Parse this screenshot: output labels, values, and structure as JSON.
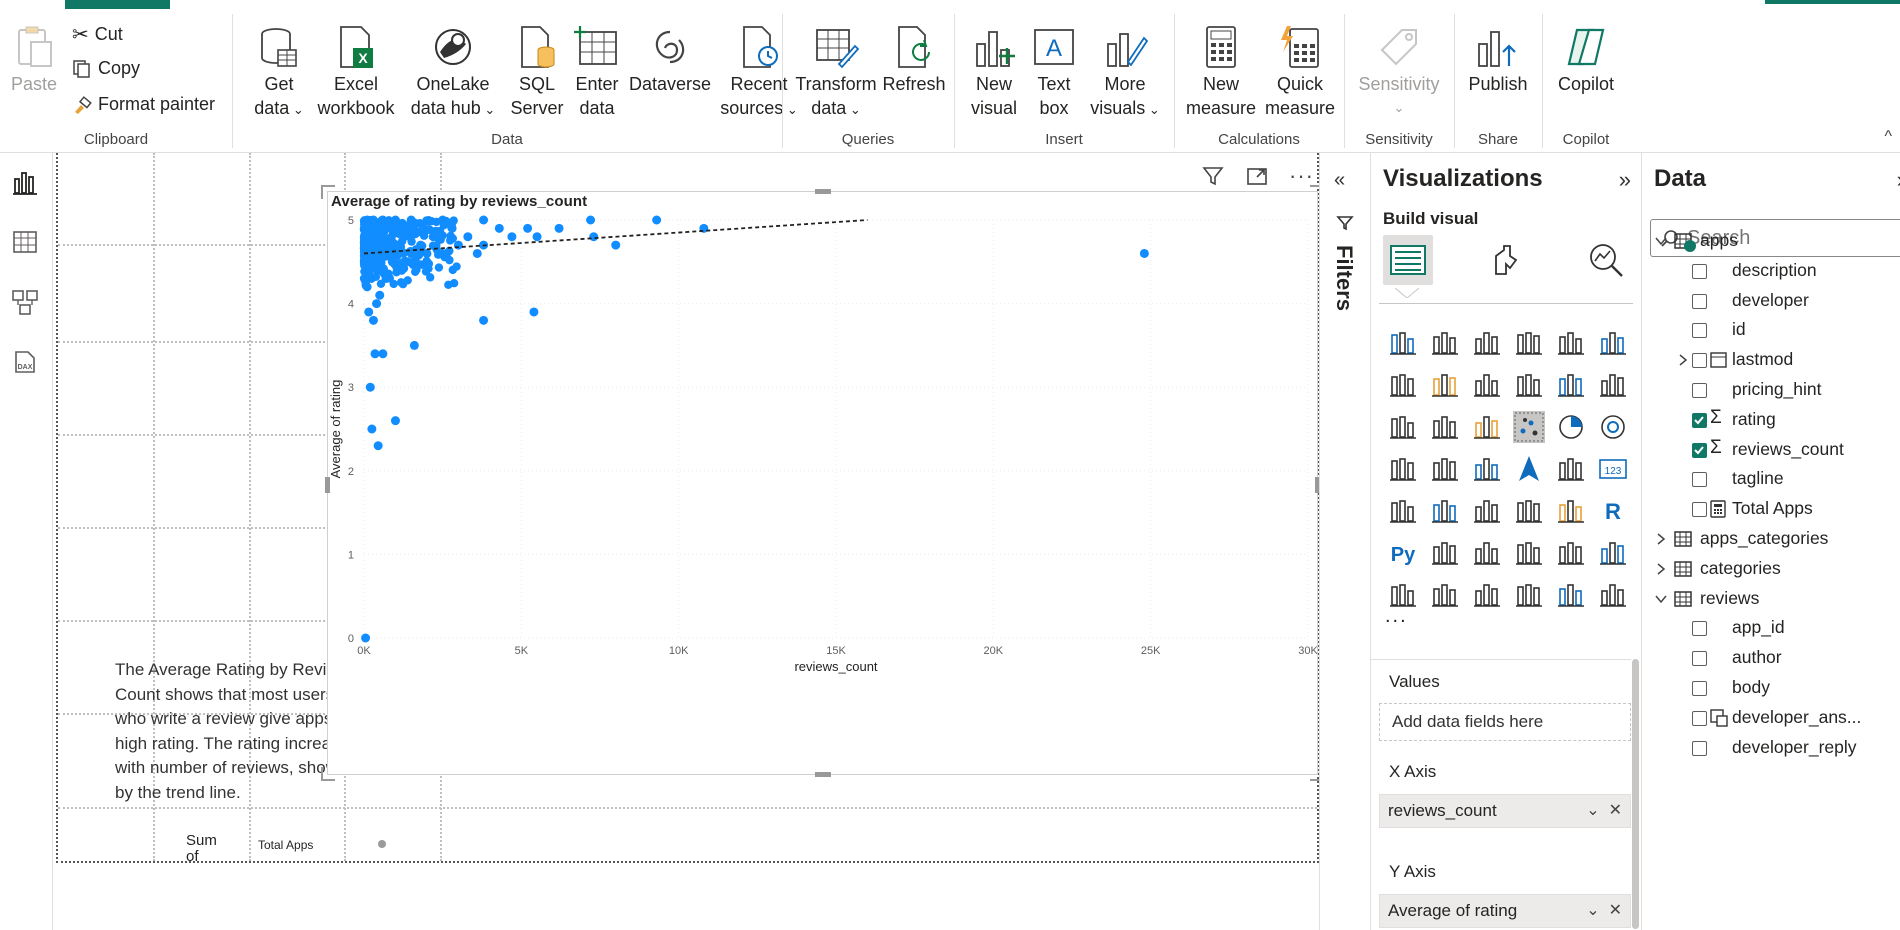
{
  "ribbon": {
    "clipboard": {
      "paste": "Paste",
      "cut": "Cut",
      "copy": "Copy",
      "format_painter": "Format painter",
      "label": "Clipboard"
    },
    "data": {
      "get_data_1": "Get",
      "get_data_2": "data",
      "excel_1": "Excel",
      "excel_2": "workbook",
      "onelake_1": "OneLake",
      "onelake_2": "data hub",
      "sql_1": "SQL",
      "sql_2": "Server",
      "enter_1": "Enter",
      "enter_2": "data",
      "dataverse": "Dataverse",
      "recent_1": "Recent",
      "recent_2": "sources",
      "label": "Data"
    },
    "queries": {
      "transform_1": "Transform",
      "transform_2": "data",
      "refresh": "Refresh",
      "label": "Queries"
    },
    "insert": {
      "new_visual_1": "New",
      "new_visual_2": "visual",
      "text_box_1": "Text",
      "text_box_2": "box",
      "more_visuals_1": "More",
      "more_visuals_2": "visuals",
      "label": "Insert"
    },
    "calculations": {
      "new_measure_1": "New",
      "new_measure_2": "measure",
      "quick_measure_1": "Quick",
      "quick_measure_2": "measure",
      "label": "Calculations"
    },
    "sensitivity": {
      "sensitivity": "Sensitivity",
      "label": "Sensitivity"
    },
    "share": {
      "publish": "Publish",
      "label": "Share"
    },
    "copilot": {
      "copilot": "Copilot",
      "label": "Copilot"
    }
  },
  "canvas": {
    "textbox": "The Average Rating by Reviews Count shows that most users who write a review give apps a high rating. The rating increases with number of reviews, shown by the trend line.",
    "bottom_visual_label_1": "Sum",
    "bottom_visual_label_2": "of",
    "bottom_visual_label_3": "Total Apps"
  },
  "chart_data": {
    "type": "scatter",
    "title": "Average of rating by reviews_count",
    "xlabel": "reviews_count",
    "ylabel": "Average of rating",
    "xlim": [
      0,
      30000
    ],
    "ylim": [
      0,
      5
    ],
    "xticks": [
      "0K",
      "5K",
      "10K",
      "15K",
      "20K",
      "25K",
      "30K"
    ],
    "yticks": [
      "0",
      "1",
      "2",
      "3",
      "4",
      "5"
    ],
    "color": "#118DFF",
    "trendline": {
      "x": [
        0,
        16000
      ],
      "y": [
        4.6,
        5.0
      ]
    },
    "points": [
      {
        "x": 24800,
        "y": 4.6
      },
      {
        "x": 10800,
        "y": 4.9
      },
      {
        "x": 9300,
        "y": 5.0
      },
      {
        "x": 8000,
        "y": 4.7
      },
      {
        "x": 7300,
        "y": 4.8
      },
      {
        "x": 6200,
        "y": 4.9
      },
      {
        "x": 5500,
        "y": 4.8
      },
      {
        "x": 5400,
        "y": 3.9
      },
      {
        "x": 5200,
        "y": 4.9
      },
      {
        "x": 4700,
        "y": 4.8
      },
      {
        "x": 4300,
        "y": 4.9
      },
      {
        "x": 3800,
        "y": 3.8
      },
      {
        "x": 3800,
        "y": 4.7
      },
      {
        "x": 3600,
        "y": 4.6
      },
      {
        "x": 3300,
        "y": 4.8
      },
      {
        "x": 3000,
        "y": 4.7
      },
      {
        "x": 2800,
        "y": 4.9
      },
      {
        "x": 2500,
        "y": 4.6
      },
      {
        "x": 2200,
        "y": 4.8
      },
      {
        "x": 2000,
        "y": 4.6
      },
      {
        "x": 1800,
        "y": 4.7
      },
      {
        "x": 1600,
        "y": 3.5
      },
      {
        "x": 1500,
        "y": 4.6
      },
      {
        "x": 1400,
        "y": 4.5
      },
      {
        "x": 1200,
        "y": 4.4
      },
      {
        "x": 1000,
        "y": 2.6
      },
      {
        "x": 900,
        "y": 4.5
      },
      {
        "x": 700,
        "y": 4.3
      },
      {
        "x": 600,
        "y": 3.4
      },
      {
        "x": 450,
        "y": 2.3
      },
      {
        "x": 350,
        "y": 3.4
      },
      {
        "x": 250,
        "y": 2.5
      },
      {
        "x": 200,
        "y": 3.0
      },
      {
        "x": 300,
        "y": 3.8
      },
      {
        "x": 400,
        "y": 4.0
      },
      {
        "x": 500,
        "y": 4.1
      },
      {
        "x": 150,
        "y": 3.9
      },
      {
        "x": 100,
        "y": 4.2
      },
      {
        "x": 50,
        "y": 0.0
      },
      {
        "x": 100,
        "y": 5.0
      },
      {
        "x": 300,
        "y": 5.0
      },
      {
        "x": 600,
        "y": 5.0
      },
      {
        "x": 1000,
        "y": 5.0
      },
      {
        "x": 1500,
        "y": 5.0
      },
      {
        "x": 2500,
        "y": 5.0
      },
      {
        "x": 3800,
        "y": 5.0
      },
      {
        "x": 7200,
        "y": 5.0
      }
    ],
    "dense_cluster": {
      "x_range": [
        0,
        3000
      ],
      "y_range": [
        4.2,
        5.0
      ]
    }
  },
  "filters": {
    "label": "Filters"
  },
  "visualizations": {
    "title": "Visualizations",
    "build_visual": "Build visual",
    "more": "...",
    "values_label": "Values",
    "values_placeholder": "Add data fields here",
    "x_axis_label": "X Axis",
    "x_axis_field": "reviews_count",
    "y_axis_label": "Y Axis",
    "y_axis_field": "Average of rating"
  },
  "data_pane": {
    "title": "Data",
    "search_placeholder": "Search",
    "tables": [
      {
        "name": "apps",
        "fields": [
          {
            "name": "description",
            "checked": false
          },
          {
            "name": "developer",
            "checked": false
          },
          {
            "name": "id",
            "checked": false
          },
          {
            "name": "lastmod",
            "checked": false
          },
          {
            "name": "pricing_hint",
            "checked": false
          },
          {
            "name": "rating",
            "checked": true
          },
          {
            "name": "reviews_count",
            "checked": true
          },
          {
            "name": "tagline",
            "checked": false
          },
          {
            "name": "Total Apps",
            "checked": false
          }
        ]
      },
      {
        "name": "apps_categories"
      },
      {
        "name": "categories"
      },
      {
        "name": "reviews",
        "fields": [
          {
            "name": "app_id",
            "checked": false
          },
          {
            "name": "author",
            "checked": false
          },
          {
            "name": "body",
            "checked": false
          },
          {
            "name": "developer_ans...",
            "checked": false
          },
          {
            "name": "developer_reply",
            "checked": false
          }
        ]
      }
    ]
  }
}
